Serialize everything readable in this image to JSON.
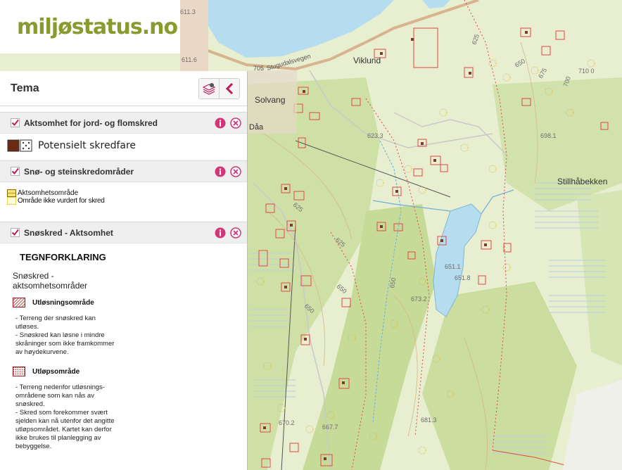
{
  "logo": {
    "text": "miljøstatus.no"
  },
  "panel": {
    "title": "Tema",
    "layers": [
      {
        "name": "Aktsomhet for jord- og flomskred",
        "checked": true,
        "legend": [
          "Potensielt skredfare"
        ]
      },
      {
        "name": "Snø- og steinskredområder",
        "checked": true,
        "legend": [
          "Aktsomhetsområde",
          "Område ikke vurdert for skred"
        ]
      },
      {
        "name": "Snøskred - Aktsomhet",
        "checked": true,
        "tegnforklaring": {
          "title": "TEGNFORKLARING",
          "subtitle_1": "Snøskred -",
          "subtitle_2": "aktsomhetsområder",
          "item1_label": "Utløsningsområde",
          "item1_lines": [
            "- Terreng der snøskred kan",
            "utløses.",
            "- Snøskred kan løsne i mindre",
            "skråninger som ikke framkommer",
            "av høydekurvene."
          ],
          "item2_label": "Utløpsområde",
          "item2_lines": [
            "- Terreng nedenfor utløsnings-",
            "områdene som kan nås av",
            "snøskred.",
            "- Skred som forekommer svært",
            "sjelden kan nå utenfor det angitte",
            "utløpsområdet. Kartet kan derfor",
            "ikke brukes til planlegging av",
            "bebyggelse."
          ]
        }
      }
    ]
  },
  "map": {
    "place_names": [
      "Viklund",
      "Solvang",
      "Stillhåbekken",
      "Stugudalsvegen",
      "705",
      "Dåa"
    ],
    "elevations": [
      "625",
      "650",
      "675",
      "700",
      "710 0",
      "623.3",
      "698.1",
      "651.1",
      "651.8",
      "673.2",
      "681.3",
      "670.2",
      "667.7",
      "611.6",
      "611.3"
    ],
    "colors": {
      "land": "#e8eed0",
      "forest": "#c9dd9c",
      "water": "#b5dcef",
      "road": "#d8b38f",
      "danger_outline": "#e04848",
      "accent": "#d1357a"
    }
  }
}
